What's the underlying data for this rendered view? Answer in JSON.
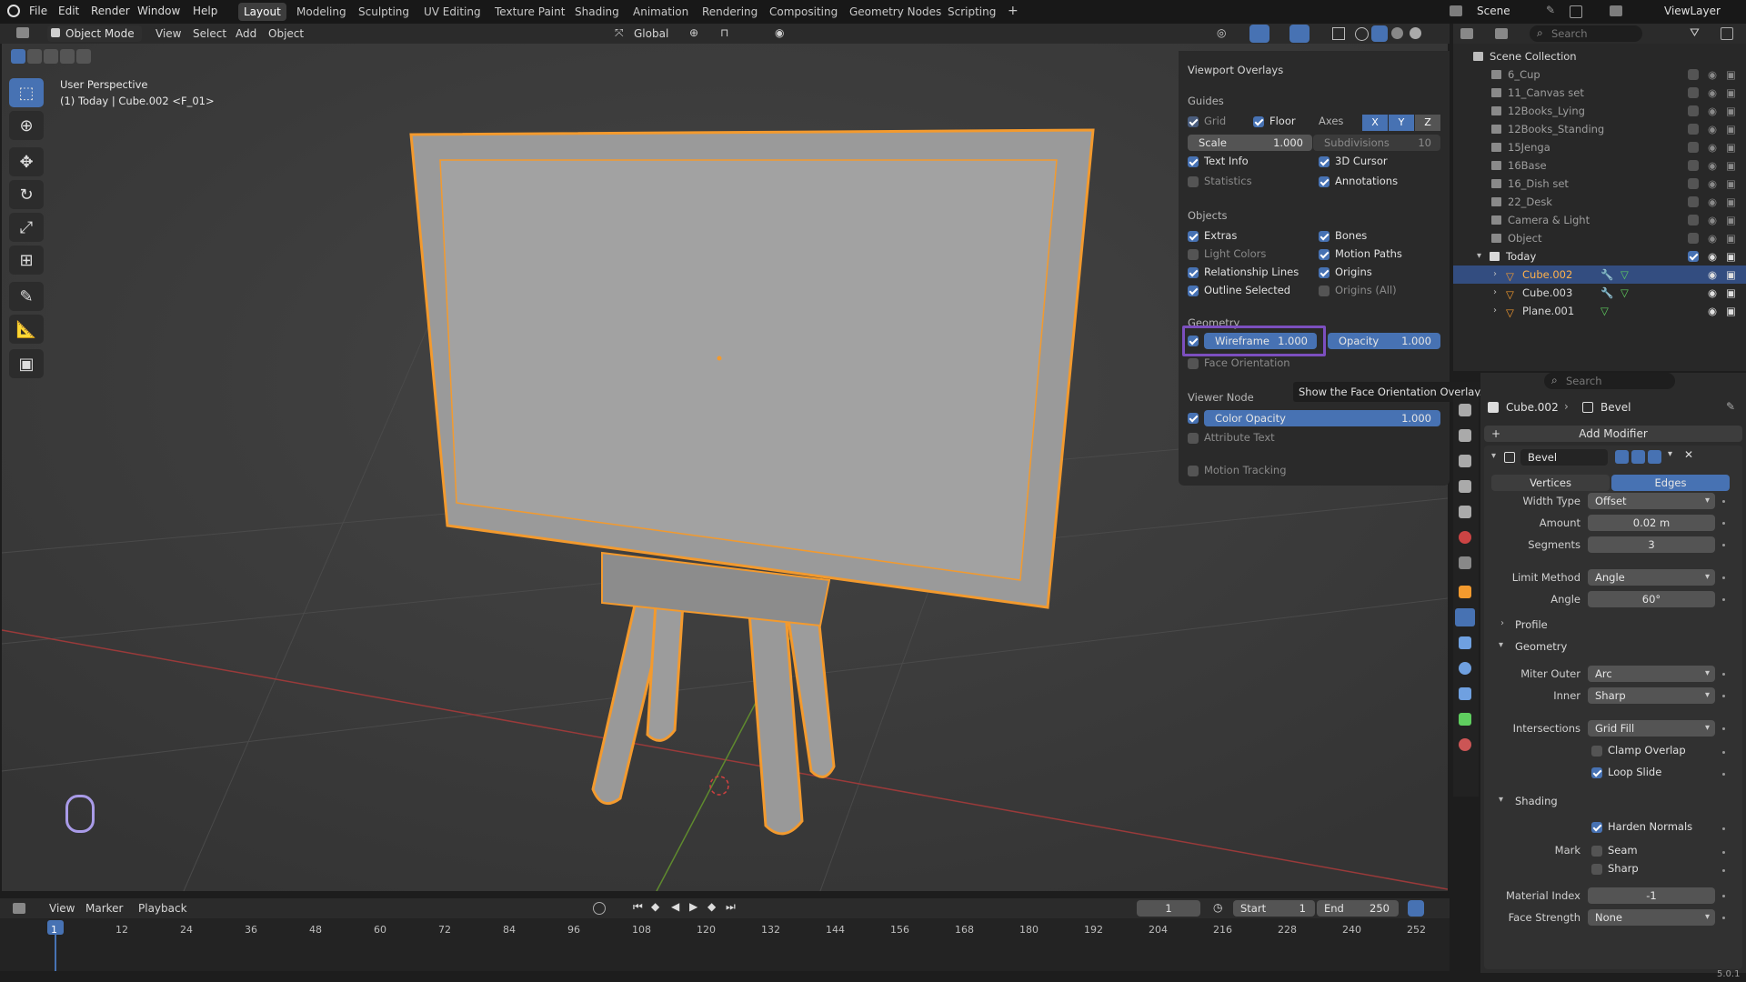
{
  "menu": [
    "File",
    "Edit",
    "Render",
    "Window",
    "Help"
  ],
  "workspaces": [
    "Layout",
    "Modeling",
    "Sculpting",
    "UV Editing",
    "Texture Paint",
    "Shading",
    "Animation",
    "Rendering",
    "Compositing",
    "Geometry Nodes",
    "Scripting"
  ],
  "scene_name": "Scene",
  "view_layer": "ViewLayer",
  "header": {
    "mode": "Object Mode",
    "view": "View",
    "select": "Select",
    "add": "Add",
    "object": "Object",
    "orientation": "Global"
  },
  "viewport": {
    "perspective": "User Perspective",
    "info": "(1) Today | Cube.002 <F_01>"
  },
  "overlays": {
    "title": "Viewport Overlays",
    "guides": "Guides",
    "grid": "Grid",
    "floor": "Floor",
    "axes": "Axes",
    "x": "X",
    "y": "Y",
    "z": "Z",
    "scale_label": "Scale",
    "scale_value": "1.000",
    "subdiv_label": "Subdivisions",
    "subdiv_value": "10",
    "text_info": "Text Info",
    "cursor_3d": "3D Cursor",
    "statistics": "Statistics",
    "annotations": "Annotations",
    "objects": "Objects",
    "extras": "Extras",
    "bones": "Bones",
    "light_colors": "Light Colors",
    "motion_paths": "Motion Paths",
    "relationship_lines": "Relationship Lines",
    "origins": "Origins",
    "outline_selected": "Outline Selected",
    "origins_all": "Origins (All)",
    "geometry": "Geometry",
    "wireframe_label": "Wireframe",
    "wireframe_value": "1.000",
    "opacity_label": "Opacity",
    "opacity_value": "1.000",
    "face_orientation": "Face Orientation",
    "tooltip": "Show the Face Orientation Overlay.",
    "viewer_node": "Viewer Node",
    "color_opacity_label": "Color Opacity",
    "color_opacity_value": "1.000",
    "attribute_text": "Attribute Text",
    "motion_tracking": "Motion Tracking"
  },
  "outliner": {
    "search_placeholder": "Search",
    "root": "Scene Collection",
    "collections": [
      "6_Cup",
      "11_Canvas set",
      "12Books_Lying",
      "12Books_Standing",
      "15Jenga",
      "16Base",
      "16_Dish set",
      "22_Desk",
      "Camera & Light",
      "Object"
    ],
    "today": "Today",
    "objects": [
      "Cube.002",
      "Cube.003",
      "Plane.001"
    ]
  },
  "properties": {
    "search_placeholder": "Search",
    "object": "Cube.002",
    "modifier": "Bevel",
    "add_modifier": "Add Modifier",
    "bevel_name": "Bevel",
    "vertices": "Vertices",
    "edges": "Edges",
    "width_type_label": "Width Type",
    "width_type": "Offset",
    "amount_label": "Amount",
    "amount": "0.02 m",
    "segments_label": "Segments",
    "segments": "3",
    "limit_label": "Limit Method",
    "limit": "Angle",
    "angle_label": "Angle",
    "angle": "60°",
    "profile": "Profile",
    "geometry": "Geometry",
    "miter_outer_label": "Miter Outer",
    "miter_outer": "Arc",
    "inner_label": "Inner",
    "inner": "Sharp",
    "intersections_label": "Intersections",
    "intersections": "Grid Fill",
    "clamp_overlap": "Clamp Overlap",
    "loop_slide": "Loop Slide",
    "shading": "Shading",
    "harden_normals": "Harden Normals",
    "mark_label": "Mark",
    "seam": "Seam",
    "sharp": "Sharp",
    "material_index_label": "Material Index",
    "material_index": "-1",
    "face_strength_label": "Face Strength",
    "face_strength": "None"
  },
  "timeline": {
    "view": "View",
    "marker": "Marker",
    "playback": "Playback",
    "current_frame": "1",
    "start_label": "Start",
    "start": "1",
    "end_label": "End",
    "end": "250",
    "ticks": [
      "1",
      "12",
      "24",
      "36",
      "48",
      "60",
      "72",
      "84",
      "96",
      "108",
      "120",
      "132",
      "144",
      "156",
      "168",
      "180",
      "192",
      "204",
      "216",
      "228",
      "240",
      "252"
    ]
  },
  "version": "5.0.1"
}
